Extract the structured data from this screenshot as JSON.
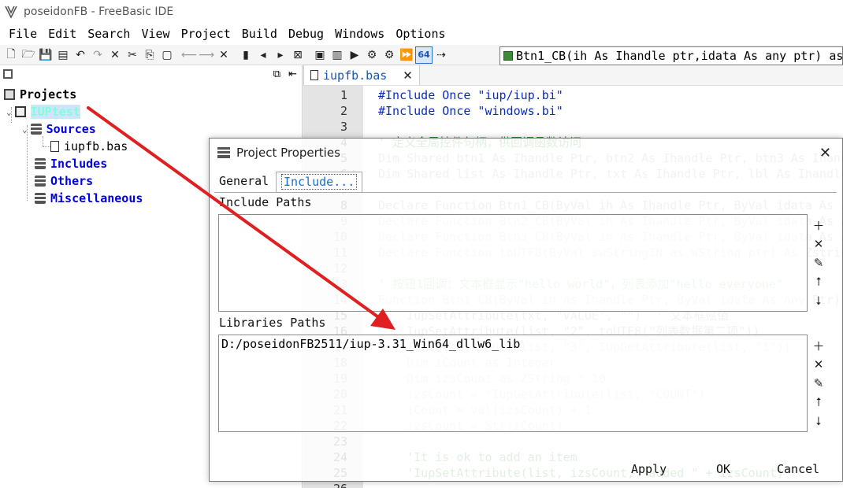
{
  "window": {
    "title": "poseidonFB - FreeBasic IDE"
  },
  "menu": [
    "File",
    "Edit",
    "Search",
    "View",
    "Project",
    "Build",
    "Debug",
    "Windows",
    "Options"
  ],
  "toolbar": {
    "mode_label": "64",
    "function_combo": "Btn1_CB(ih As Ihandle ptr,idata As any ptr) as"
  },
  "project_panel": {
    "root": "Projects",
    "project": "IUPtest",
    "sources": "Sources",
    "source_file": "iupfb.bas",
    "includes": "Includes",
    "others": "Others",
    "misc": "Miscellaneous"
  },
  "editor": {
    "tab": "iupfb.bas",
    "lines": [
      {
        "n": "1",
        "code": "#Include Once \"iup/iup.bi\""
      },
      {
        "n": "2",
        "code": "#Include Once \"windows.bi\""
      },
      {
        "n": "3",
        "code": ""
      },
      {
        "n": "4",
        "code": "' 定义全局控件句柄，供回调函数访问"
      },
      {
        "n": "5",
        "code": "Dim Shared btn1 As Ihandle Ptr, btn2 As Ihandle Ptr, btn3 As Ihandle"
      },
      {
        "n": "6",
        "code": "Dim Shared list As Ihandle Ptr, txt As Ihandle Ptr, lbl As Ihandle"
      },
      {
        "n": "7",
        "code": ""
      },
      {
        "n": "8",
        "code": "Declare Function Btn1_CB(ByVal ih As Ihandle Ptr, ByVal idata As A"
      },
      {
        "n": "9",
        "code": "Declare Function Btn2_CB(ByVal ih As Ihandle Ptr, ByVal idata As A"
      },
      {
        "n": "10",
        "code": "Declare Function Btn3_CB(ByVal ih As Ihandle Ptr, ByVal idata As A"
      },
      {
        "n": "11",
        "code": "Declare Function toUTF8(ByVal swStringIN as WString ptr) As Zstrin"
      },
      {
        "n": "12",
        "code": ""
      },
      {
        "n": "13",
        "code": "' 按钮1回调：文本框显示\"hello world\"，列表添加\"hello everyone\""
      },
      {
        "n": "14",
        "code": "Function Btn1_CB(ByVal ih As Ihandle Ptr, ByVal idata As Any Ptr)"
      },
      {
        "n": "15",
        "code": "    IupSetAttribute(txt, \"VALUE\", \"\")  ' 文本框赋值"
      },
      {
        "n": "16",
        "code": "    IupSetAttribute(list, \"2\", toUTF8(\"列表数据第二项\"))"
      },
      {
        "n": "17",
        "code": "    IupSetAttribute(list, \"3\", IupGetAttribute(list, \"1\"))"
      },
      {
        "n": "18",
        "code": "    Dim iCount as Integer"
      },
      {
        "n": "19",
        "code": "    Dim izsCount as ZString * 10"
      },
      {
        "n": "20",
        "code": "    izsCount = *IupGetAttribute(list, \"COUNT\")"
      },
      {
        "n": "21",
        "code": "    iCount = val(izsCount) + 1"
      },
      {
        "n": "22",
        "code": "    izsCount = Str(iCount)"
      },
      {
        "n": "23",
        "code": ""
      },
      {
        "n": "24",
        "code": "    'It is ok to add an item"
      },
      {
        "n": "25",
        "code": "    'IupSetAttribute(list, izsCount, \"added \" + izsCount)"
      },
      {
        "n": "26",
        "code": ""
      }
    ]
  },
  "dialog": {
    "title": "Project Properties",
    "tabs": {
      "general": "General",
      "include": "Include..."
    },
    "include_paths_label": "Include Paths",
    "include_paths": [],
    "libraries_paths_label": "Libraries Paths",
    "libraries_paths": [
      "D:/poseidonFB2511/iup-3.31_Win64_dllw6_lib"
    ],
    "buttons": {
      "apply": "Apply",
      "ok": "OK",
      "cancel": "Cancel"
    }
  },
  "colors": {
    "arrow": "#e02020",
    "link_blue": "#0000e6",
    "tab_blue": "#1a6fd0"
  }
}
